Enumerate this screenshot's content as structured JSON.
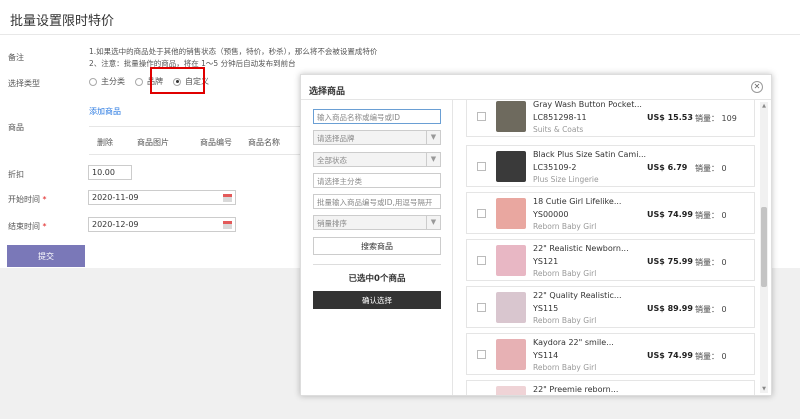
{
  "page": {
    "title": "批量设置限时特价",
    "labels": {
      "remark": "备注",
      "type": "选择类型",
      "goods": "商品",
      "discount": "折扣",
      "start": "开始时间",
      "end": "结束时间",
      "required_mark": "*"
    },
    "notes": [
      "1.如果选中的商品处于其他的销售状态（预售，特价，秒杀），那么将不会被设置成特价",
      "2、注意：批量操作的商品，将在 1～5 分钟后自动发布到前台"
    ],
    "type_options": [
      "主分类",
      "品牌",
      "自定义"
    ],
    "type_selected": "自定义",
    "add_goods_link": "添加商品",
    "table_headers": [
      "删除",
      "商品图片",
      "商品编号",
      "商品名称"
    ],
    "discount_value": "10.00",
    "start_date": "2020-11-09",
    "end_date": "2020-12-09",
    "submit_label": "提交",
    "highlight_color": "#e00000"
  },
  "modal": {
    "title": "选择商品",
    "close_icon": "close-icon",
    "filters": {
      "keyword_placeholder": "输入商品名称或编号或ID",
      "brand_placeholder": "请选择品牌",
      "status_placeholder": "全部状态",
      "category_placeholder": "请选择主分类",
      "batch_placeholder": "批量输入商品编号或ID,用逗号隔开",
      "sort_placeholder": "销量排序"
    },
    "search_button": "搜索商品",
    "selected_count": "已选中0个商品",
    "confirm_button": "确认选择",
    "products": [
      {
        "name": "Gray Wash Button Pocket...",
        "code": "LC851298-11",
        "category": "Suits & Coats",
        "price": "US$ 15.53",
        "sales": "销量： 109",
        "thumb_color": "#6e6a5e"
      },
      {
        "name": "Black Plus Size Satin Cami...",
        "code": "LC35109-2",
        "category": "Plus Size Lingerie",
        "price": "US$ 6.79",
        "sales": "销量： 0",
        "thumb_color": "#3a3a3a"
      },
      {
        "name": "18 Cutie Girl Lifelike...",
        "code": "YS00000",
        "category": "Reborn Baby Girl",
        "price": "US$ 74.99",
        "sales": "销量： 0",
        "thumb_color": "#e9a7a0"
      },
      {
        "name": "22\" Realistic Newborn...",
        "code": "YS121",
        "category": "Reborn Baby Girl",
        "price": "US$ 75.99",
        "sales": "销量： 0",
        "thumb_color": "#e8b7c4"
      },
      {
        "name": "22\" Quality Realistic...",
        "code": "YS115",
        "category": "Reborn Baby Girl",
        "price": "US$ 89.99",
        "sales": "销量： 0",
        "thumb_color": "#d9c6cf"
      },
      {
        "name": "Kaydora 22\" smile...",
        "code": "YS114",
        "category": "Reborn Baby Girl",
        "price": "US$ 74.99",
        "sales": "销量： 0",
        "thumb_color": "#e7b1b4"
      },
      {
        "name": "22\" Preemie reborn...",
        "code": "",
        "category": "",
        "price": "",
        "sales": "",
        "thumb_color": "#efd3d6"
      }
    ]
  }
}
